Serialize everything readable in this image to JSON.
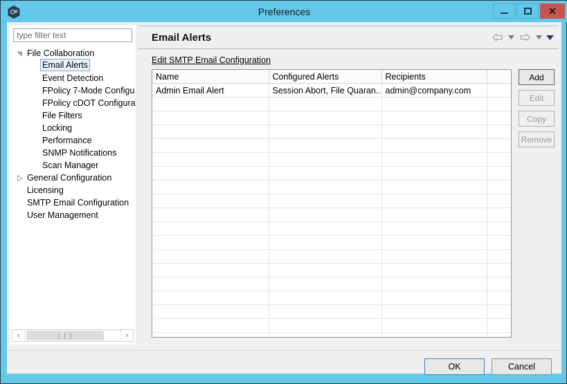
{
  "window": {
    "title": "Preferences",
    "icon": "app-hexagon-icon",
    "caption_buttons": {
      "minimize": "minimize-icon",
      "maximize": "maximize-icon",
      "close": "✕"
    },
    "colors": {
      "titlebar": "#63c8ea",
      "close_button": "#c75450",
      "dialog_background": "#efefef",
      "selection": "#e9f2fb",
      "selection_border": "#7da2ce",
      "ok_focus_border": "#3d7eb5"
    }
  },
  "sidebar": {
    "filter": {
      "value": "",
      "placeholder": "type filter text"
    },
    "items": [
      {
        "label": "File Collaboration",
        "level": 0,
        "twisty": "expanded",
        "selected": false
      },
      {
        "label": "Email Alerts",
        "level": 1,
        "twisty": "none",
        "selected": true
      },
      {
        "label": "Event Detection",
        "level": 1,
        "twisty": "none",
        "selected": false
      },
      {
        "label": "FPolicy 7-Mode Configu",
        "level": 1,
        "twisty": "none",
        "selected": false
      },
      {
        "label": "FPolicy cDOT Configura",
        "level": 1,
        "twisty": "none",
        "selected": false
      },
      {
        "label": "File Filters",
        "level": 1,
        "twisty": "none",
        "selected": false
      },
      {
        "label": "Locking",
        "level": 1,
        "twisty": "none",
        "selected": false
      },
      {
        "label": "Performance",
        "level": 1,
        "twisty": "none",
        "selected": false
      },
      {
        "label": "SNMP Notifications",
        "level": 1,
        "twisty": "none",
        "selected": false
      },
      {
        "label": "Scan Manager",
        "level": 1,
        "twisty": "none",
        "selected": false
      },
      {
        "label": "General Configuration",
        "level": 0,
        "twisty": "collapsed",
        "selected": false
      },
      {
        "label": "Licensing",
        "level": 0,
        "twisty": "none",
        "selected": false
      },
      {
        "label": "SMTP Email Configuration",
        "level": 0,
        "twisty": "none",
        "selected": false
      },
      {
        "label": "User Management",
        "level": 0,
        "twisty": "none",
        "selected": false
      }
    ],
    "scrollbar": {
      "left_arrow": "‹",
      "right_arrow": "›",
      "grip": "❘❘❘"
    }
  },
  "content": {
    "title": "Email Alerts",
    "link_label": "Edit SMTP Email Configuration",
    "nav": {
      "back": "back-arrow-icon",
      "back_menu": "chevron-down-icon",
      "forward": "forward-arrow-icon",
      "forward_menu": "chevron-down-icon",
      "more": "chevron-down-filled-icon"
    },
    "table": {
      "columns": [
        "Name",
        "Configured Alerts",
        "Recipients",
        ""
      ],
      "rows": [
        [
          "Admin Email Alert",
          "Session Abort, File Quaran...",
          "admin@company.com",
          ""
        ]
      ],
      "empty_row_count": 18
    },
    "side_buttons": [
      {
        "label": "Add",
        "enabled": true
      },
      {
        "label": "Edit",
        "enabled": false
      },
      {
        "label": "Copy",
        "enabled": false
      },
      {
        "label": "Remove",
        "enabled": false
      }
    ]
  },
  "footer": {
    "ok_label": "OK",
    "cancel_label": "Cancel"
  }
}
